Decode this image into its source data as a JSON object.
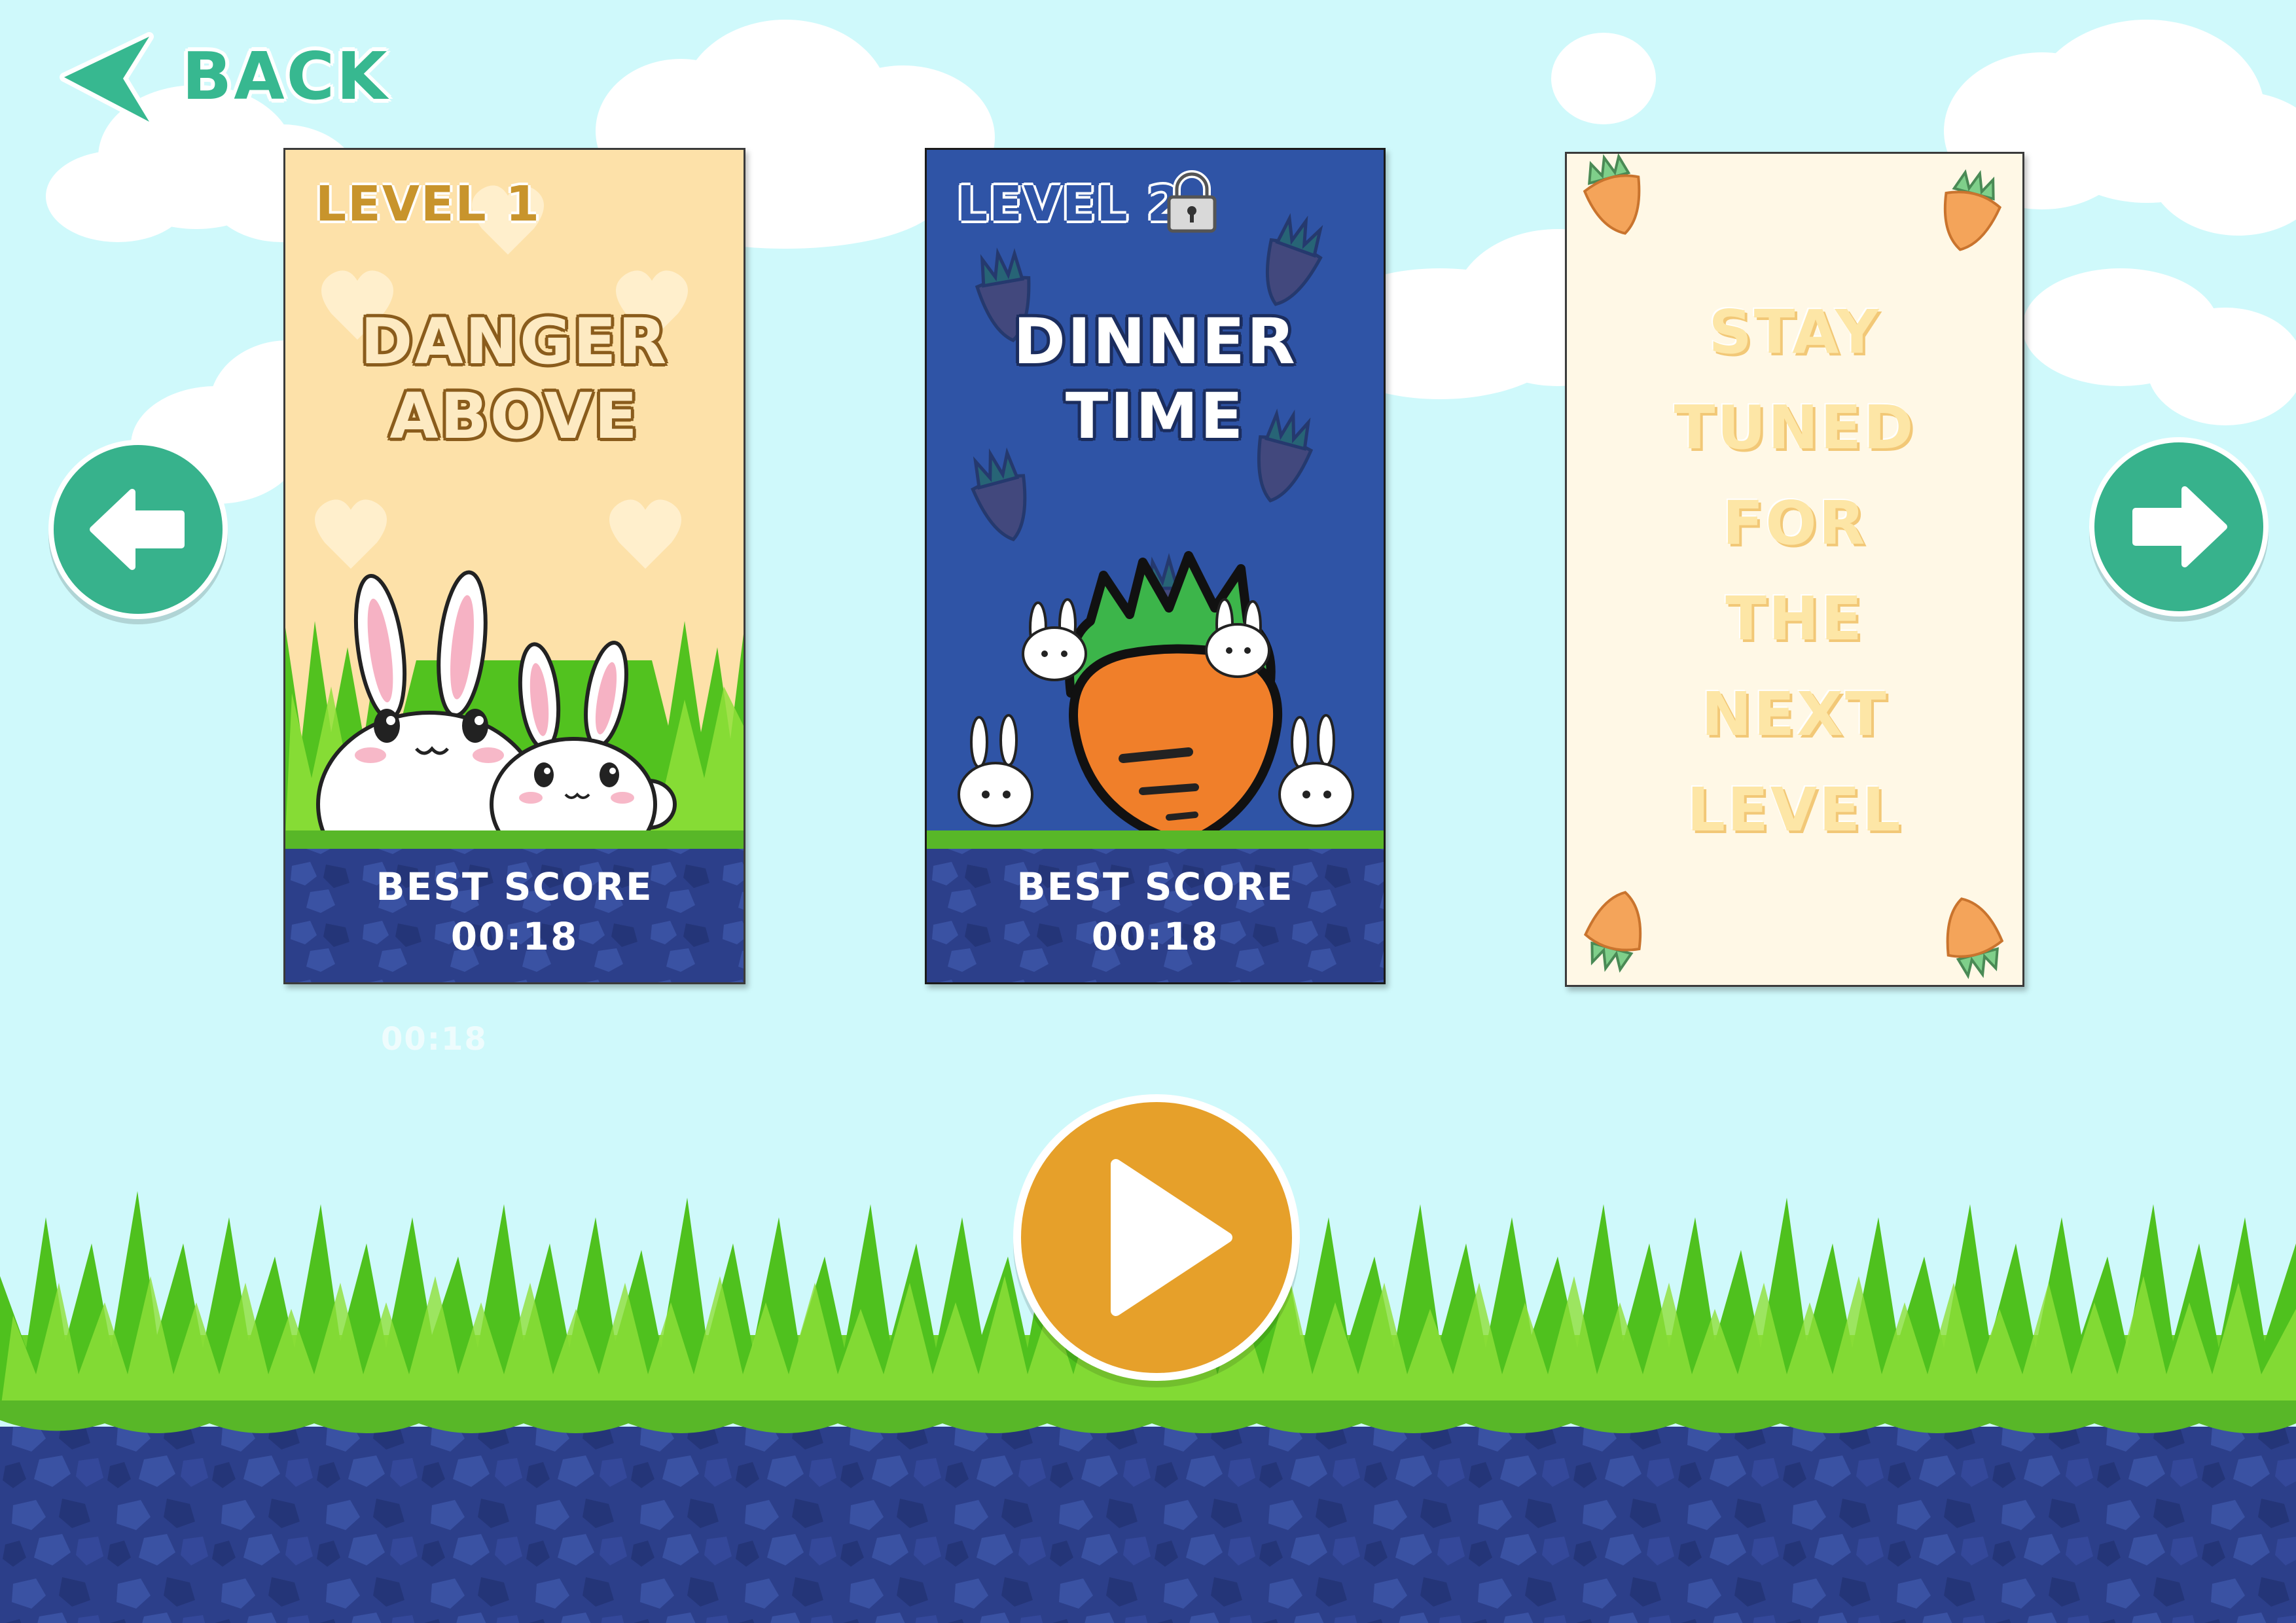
{
  "header": {
    "back_label": "BACK"
  },
  "levels": [
    {
      "level_label": "LEVEL 1",
      "title_line1": "DANGER",
      "title_line2": "ABOVE",
      "best_label": "BEST SCORE",
      "best_time": "00:18",
      "locked": false
    },
    {
      "level_label": "LEVEL 2",
      "title_line1": "DINNER",
      "title_line2": "TIME",
      "best_label": "BEST SCORE",
      "best_time": "00:18",
      "locked": true
    }
  ],
  "coming_soon": {
    "lines": [
      "STAY",
      "TUNED",
      "FOR",
      "THE",
      "NEXT",
      "LEVEL"
    ]
  },
  "stray_time": "00:18",
  "icons": {
    "back": "back-arrow-icon",
    "prev": "arrow-left-icon",
    "next": "arrow-right-icon",
    "play": "play-icon",
    "lock": "lock-icon"
  },
  "colors": {
    "sky": "#cff9fb",
    "accent_green": "#37b28c",
    "play_orange": "#e6a02a",
    "card1_bg": "#fde1a9",
    "card2_bg": "#2f54a6",
    "card3_bg": "#fff8e6",
    "grass": "#4fc11e",
    "soil": "#2b3f88"
  }
}
